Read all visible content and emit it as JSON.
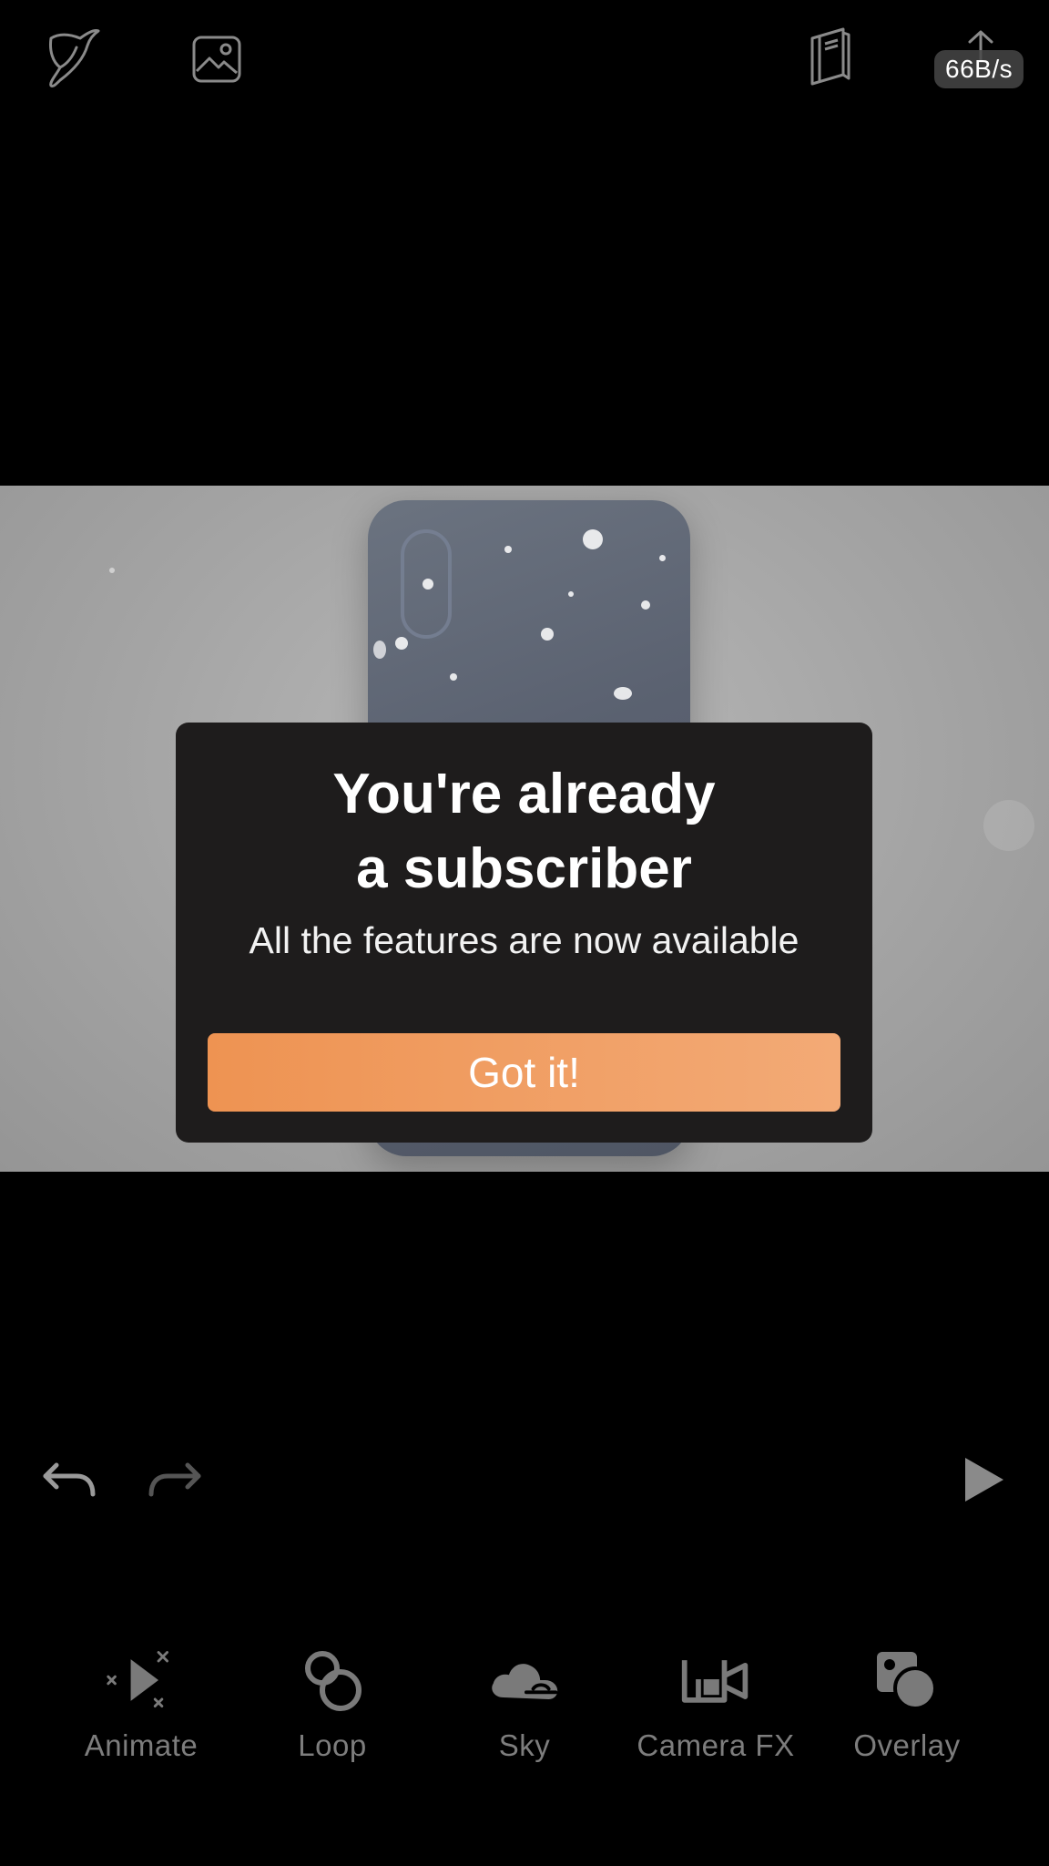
{
  "status": {
    "network_speed": "66B/s"
  },
  "top_bar": {
    "left_icons": [
      "bird-logo-icon",
      "gallery-icon"
    ],
    "right_icons": [
      "book-icon",
      "share-upload-icon"
    ]
  },
  "dialog": {
    "title": "You're already\na subscriber",
    "subtitle": "All the features are now available",
    "button_label": "Got it!",
    "button_color": "#F09B5E"
  },
  "playback": {
    "undo_icon": "undo-icon",
    "redo_icon": "redo-icon",
    "play_icon": "play-icon"
  },
  "toolbar": {
    "items": [
      {
        "label": "Animate",
        "icon": "animate-icon"
      },
      {
        "label": "Loop",
        "icon": "loop-icon"
      },
      {
        "label": "Sky",
        "icon": "sky-icon"
      },
      {
        "label": "Camera FX",
        "icon": "camera-fx-icon"
      },
      {
        "label": "Overlay",
        "icon": "overlay-icon"
      }
    ]
  },
  "colors": {
    "background": "#000000",
    "dialog_bg": "#1E1C1C",
    "toolbar_text": "#7D7D7D"
  }
}
